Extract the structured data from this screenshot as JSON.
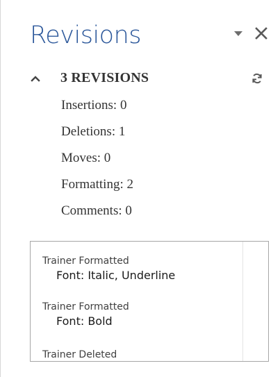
{
  "pane": {
    "title": "Revisions",
    "menu_icon": "dropdown-triangle-icon",
    "close_icon": "close-icon"
  },
  "summary": {
    "title": "3 REVISIONS",
    "collapse_icon": "chevron-up-icon",
    "refresh_icon": "refresh-icon",
    "stats": [
      {
        "label": "Insertions: 0"
      },
      {
        "label": "Deletions: 1"
      },
      {
        "label": "Moves: 0"
      },
      {
        "label": "Formatting: 2"
      },
      {
        "label": "Comments: 0"
      }
    ]
  },
  "revisions": [
    {
      "author": "Trainer Formatted",
      "detail": "Font: Italic, Underline"
    },
    {
      "author": "Trainer Formatted",
      "detail": "Font: Bold"
    },
    {
      "author": "Trainer Deleted",
      "detail": ""
    }
  ],
  "colors": {
    "title": "#2b579a",
    "text": "#333333",
    "border": "#a6a6a6"
  }
}
